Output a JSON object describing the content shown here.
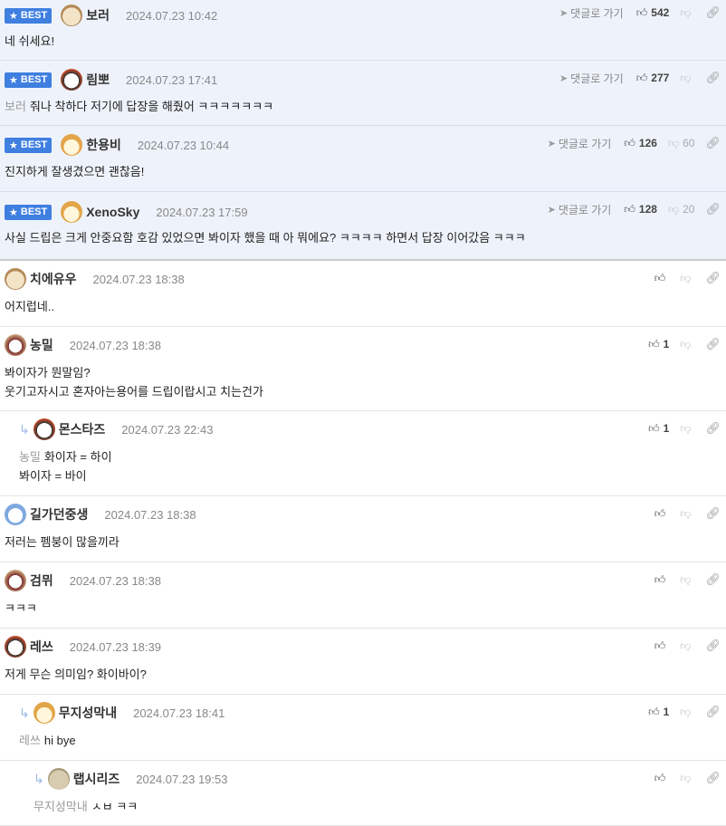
{
  "labels": {
    "best": "BEST",
    "reply": "댓글로 가기"
  },
  "comments": [
    {
      "nick": "보러",
      "date": "2024.07.23 10:42",
      "text": "네 쉬세요!",
      "up": "542",
      "down": ""
    },
    {
      "nick": "림뽀",
      "date": "2024.07.23 17:41",
      "mention": "보러",
      "text": "줘나 착하다 저기에 답장을 해줬어 ㅋㅋㅋㅋㅋㅋㅋ",
      "up": "277",
      "down": ""
    },
    {
      "nick": "한용비",
      "date": "2024.07.23 10:44",
      "text": "진지하게 잘생겼으면 괜찮음!",
      "up": "126",
      "down": "60"
    },
    {
      "nick": "XenoSky",
      "date": "2024.07.23 17:59",
      "text": "사실 드립은 크게 안중요함 호감 있었으면 봐이자 했을 때 아 뭐에요? ㅋㅋㅋㅋ 하면서 답장 이어갔음 ㅋㅋㅋ",
      "up": "128",
      "down": "20"
    },
    {
      "nick": "치에유우",
      "date": "2024.07.23 18:38",
      "text": "어지럽네..",
      "up": "",
      "down": ""
    },
    {
      "nick": "농밀",
      "date": "2024.07.23 18:38",
      "text": "봐이자가 뭔말임?",
      "text2": "웃기고자시고 혼자아는용어를 드립이랍시고 치는건가",
      "up": "1",
      "down": ""
    },
    {
      "nick": "몬스타즈",
      "date": "2024.07.23 22:43",
      "mention": "농밀",
      "text": "화이자 = 하이",
      "text2": "봐이자 = 바이",
      "up": "1",
      "down": ""
    },
    {
      "nick": "길가던중생",
      "date": "2024.07.23 18:38",
      "text": "저러는 펨붕이 많을끼라",
      "up": "",
      "down": ""
    },
    {
      "nick": "검뮈",
      "date": "2024.07.23 18:38",
      "text": "ㅋㅋㅋ",
      "up": "",
      "down": ""
    },
    {
      "nick": "레쓰",
      "date": "2024.07.23 18:39",
      "text": "저게 무슨 의미임? 화이바이?",
      "up": "",
      "down": ""
    },
    {
      "nick": "무지성막내",
      "date": "2024.07.23 18:41",
      "mention": "레쓰",
      "text": "hi bye",
      "up": "1",
      "down": ""
    },
    {
      "nick": "랩시리즈",
      "date": "2024.07.23 19:53",
      "mention": "무지성막내",
      "text": "ㅅㅂ ㅋㅋ",
      "up": "",
      "down": ""
    }
  ],
  "icons": {
    "up": "thumbs-up-icon",
    "down": "thumbs-down-icon",
    "link": "link-icon",
    "reply": "send-icon"
  },
  "colors": {
    "best_bg": "#eef3fb",
    "badge": "#3f7fe0"
  }
}
